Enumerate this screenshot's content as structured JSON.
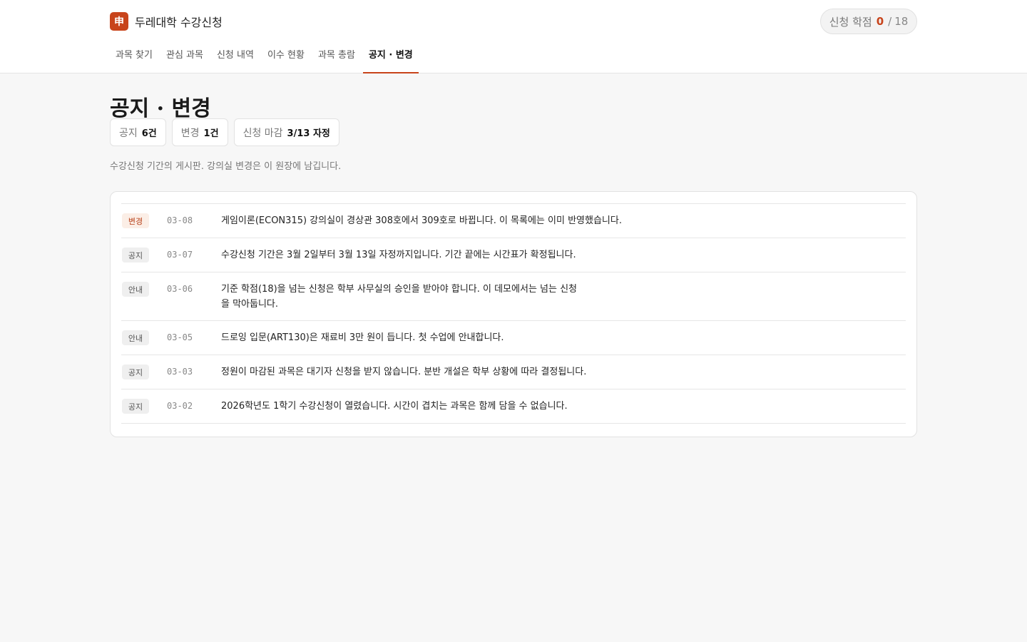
{
  "brand": {
    "logo_glyph": "申",
    "name": "두레대학 수강신청"
  },
  "credits": {
    "label": "신청 학점",
    "current": "0",
    "separator": "/",
    "max": "18"
  },
  "tabs": [
    {
      "label": "과목 찾기",
      "active": false
    },
    {
      "label": "관심 과목",
      "active": false
    },
    {
      "label": "신청 내역",
      "active": false
    },
    {
      "label": "이수 현황",
      "active": false
    },
    {
      "label": "과목 총람",
      "active": false
    },
    {
      "label": "공지 · 변경",
      "active": true
    }
  ],
  "page": {
    "title": "공지 · 변경",
    "stats": [
      {
        "label": "공지",
        "value": "6건"
      },
      {
        "label": "변경",
        "value": "1건"
      },
      {
        "label": "신청 마감",
        "value": "3/13 자정"
      }
    ],
    "description": "수강신청 기간의 게시판. 강의실 변경은 이 원장에 남깁니다."
  },
  "notices": [
    {
      "type": "변경",
      "date": "03-08",
      "text": "게임이론(ECON315) 강의실이 경상관 308호에서 309호로 바뀝니다. 이 목록에는 이미 반영했습니다."
    },
    {
      "type": "공지",
      "date": "03-07",
      "text": "수강신청 기간은 3월 2일부터 3월 13일 자정까지입니다. 기간 끝에는 시간표가 확정됩니다."
    },
    {
      "type": "안내",
      "date": "03-06",
      "text": "기준 학점(18)을 넘는 신청은 학부 사무실의 승인을 받아야 합니다. 이 데모에서는 넘는 신청을 막아둡니다."
    },
    {
      "type": "안내",
      "date": "03-05",
      "text": "드로잉 입문(ART130)은 재료비 3만 원이 듭니다. 첫 수업에 안내합니다."
    },
    {
      "type": "공지",
      "date": "03-03",
      "text": "정원이 마감된 과목은 대기자 신청을 받지 않습니다. 분반 개설은 학부 상황에 따라 결정됩니다."
    },
    {
      "type": "공지",
      "date": "03-02",
      "text": "2026학년도 1학기 수강신청이 열렸습니다. 시간이 겹치는 과목은 함께 담을 수 없습니다."
    }
  ]
}
